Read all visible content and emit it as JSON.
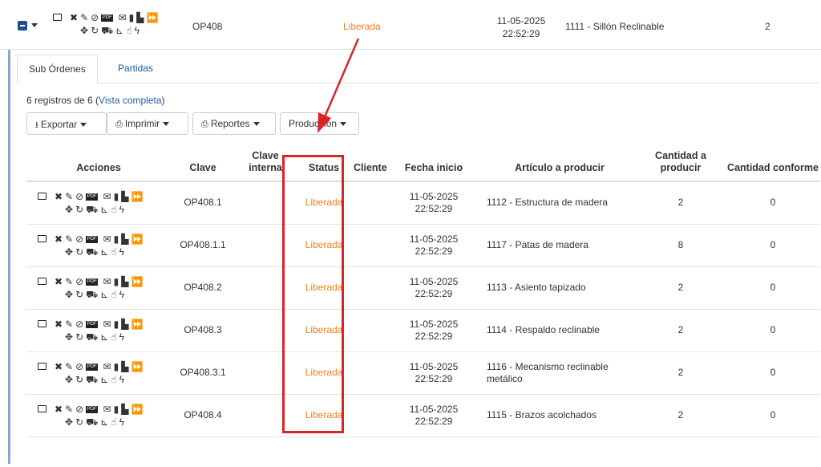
{
  "parent": {
    "clave": "OP408",
    "status": "Liberada",
    "fecha_line1": "11-05-2025",
    "fecha_line2": "22:52:29",
    "articulo": "1111 - Sillón Reclinable",
    "cantidad": "2"
  },
  "tabs": [
    {
      "label": "Sub Órdenes",
      "active": true
    },
    {
      "label": "Partidas",
      "active": false
    }
  ],
  "records": {
    "text": "6 registros de 6 (",
    "link": "Vista completa",
    "close": ")"
  },
  "toolbar": {
    "exportar": "Exportar",
    "imprimir": "Imprimir",
    "reportes": "Reportes",
    "produccion": "Producción"
  },
  "columns": {
    "acciones": "Acciones",
    "clave": "Clave",
    "clave_interna": "Clave interna",
    "status": "Status",
    "cliente": "Cliente",
    "fecha_inicio": "Fecha inicio",
    "articulo": "Artículo a producir",
    "cantidad_producir": "Cantidad a producir",
    "cantidad_conforme": "Cantidad conforme"
  },
  "rows": [
    {
      "clave": "OP408.1",
      "status": "Liberada",
      "fecha1": "11-05-2025",
      "fecha2": "22:52:29",
      "articulo": "1112 - Estructura de madera",
      "cantidad": "2",
      "conforme": "0"
    },
    {
      "clave": "OP408.1.1",
      "status": "Liberada",
      "fecha1": "11-05-2025",
      "fecha2": "22:52:29",
      "articulo": "1117 - Patas de madera",
      "cantidad": "8",
      "conforme": "0"
    },
    {
      "clave": "OP408.2",
      "status": "Liberada",
      "fecha1": "11-05-2025",
      "fecha2": "22:52:29",
      "articulo": "1113 - Asiento tapizado",
      "cantidad": "2",
      "conforme": "0"
    },
    {
      "clave": "OP408.3",
      "status": "Liberada",
      "fecha1": "11-05-2025",
      "fecha2": "22:52:29",
      "articulo": "1114 - Respaldo reclinable",
      "cantidad": "2",
      "conforme": "0"
    },
    {
      "clave": "OP408.3.1",
      "status": "Liberada",
      "fecha1": "11-05-2025",
      "fecha2": "22:52:29",
      "articulo": "1116 - Mecanismo reclinable metálico",
      "cantidad": "2",
      "conforme": "0"
    },
    {
      "clave": "OP408.4",
      "status": "Liberada",
      "fecha1": "11-05-2025",
      "fecha2": "22:52:29",
      "articulo": "1115 - Brazos acolchados",
      "cantidad": "2",
      "conforme": "0"
    }
  ],
  "colors": {
    "status": "#f0821e",
    "link": "#1f5da8",
    "annotation": "#d9252a"
  },
  "icons": [
    "id-card-icon",
    "delete-icon",
    "edit-icon",
    "attach-icon",
    "pdf-icon",
    "mail-icon",
    "mobile-icon",
    "barcode-icon",
    "forward-icon",
    "move-icon",
    "refresh-icon",
    "truck-icon",
    "dolly-icon",
    "hand-icon",
    "bolt-icon"
  ]
}
